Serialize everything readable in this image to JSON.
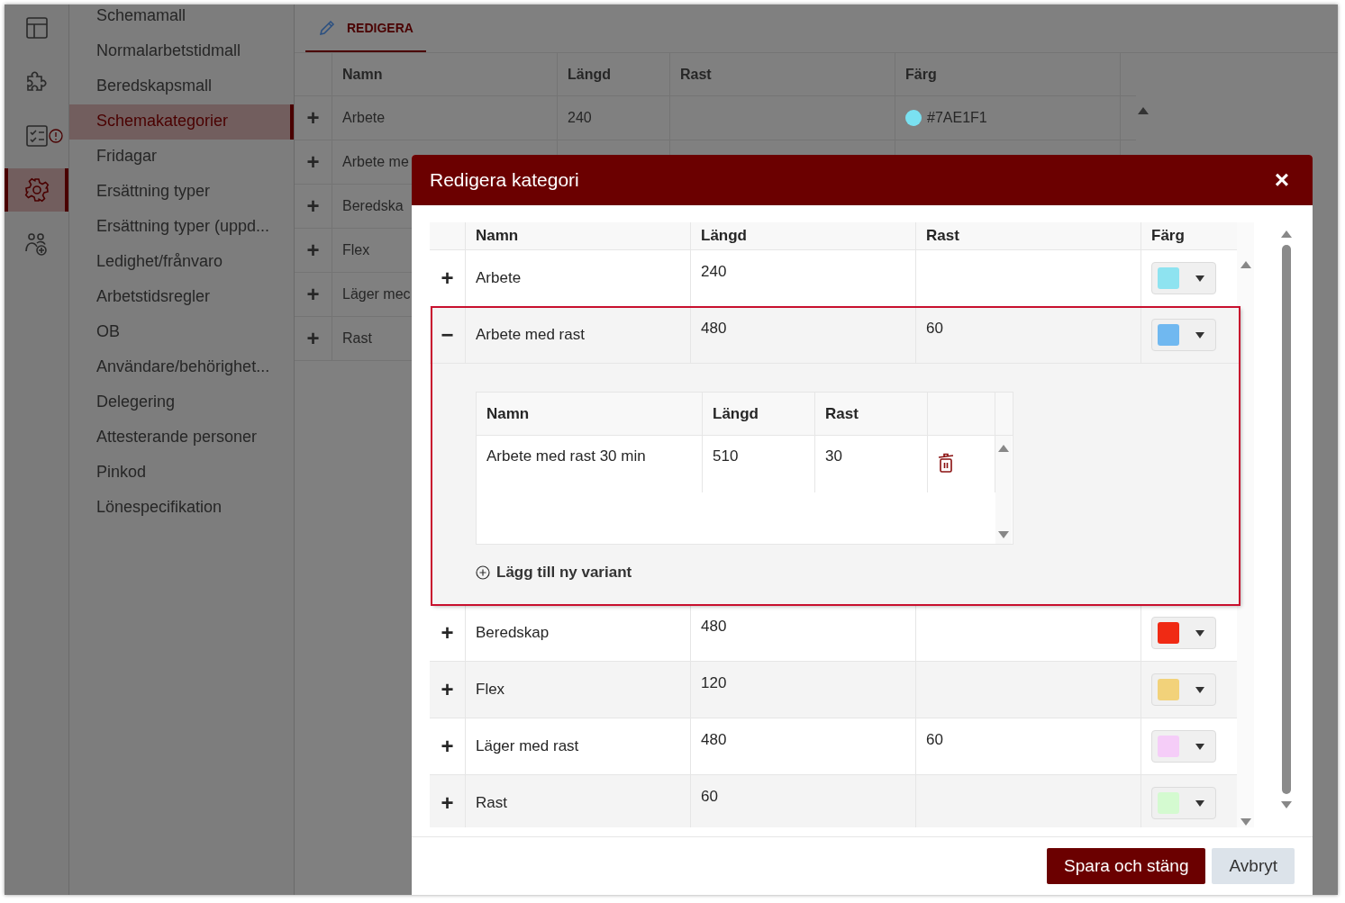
{
  "rail": [
    {
      "kind": "layout",
      "selected": false,
      "alert": false
    },
    {
      "kind": "puzzle",
      "selected": false,
      "alert": false
    },
    {
      "kind": "checklist",
      "selected": false,
      "alert": true
    },
    {
      "kind": "gear",
      "selected": true,
      "alert": false
    },
    {
      "kind": "users",
      "selected": false,
      "alert": false
    }
  ],
  "nav": [
    {
      "label": "Schemamall",
      "selected": false
    },
    {
      "label": "Normalarbetstidmall",
      "selected": false
    },
    {
      "label": "Beredskapsmall",
      "selected": false
    },
    {
      "label": "Schemakategorier",
      "selected": true
    },
    {
      "label": "Fridagar",
      "selected": false
    },
    {
      "label": "Ersättning typer",
      "selected": false
    },
    {
      "label": "Ersättning typer (uppd...",
      "selected": false
    },
    {
      "label": "Ledighet/frånvaro",
      "selected": false
    },
    {
      "label": "Arbetstidsregler",
      "selected": false
    },
    {
      "label": "OB",
      "selected": false
    },
    {
      "label": "Användare/behörighet...",
      "selected": false
    },
    {
      "label": "Delegering",
      "selected": false
    },
    {
      "label": "Attesterande personer",
      "selected": false
    },
    {
      "label": "Pinkod",
      "selected": false
    },
    {
      "label": "Lönespecifikation",
      "selected": false
    }
  ],
  "tab": {
    "label": "REDIGERA",
    "selected": true
  },
  "table": {
    "columns": [
      "Namn",
      "Längd",
      "Rast",
      "Färg"
    ],
    "rows": [
      {
        "toggle": "+",
        "name": "Arbete",
        "length": "240",
        "color_text": "#7AE1F1",
        "color": "#7ae1f1"
      },
      {
        "toggle": "+",
        "name": "Arbete me"
      },
      {
        "toggle": "+",
        "name": "Beredska"
      },
      {
        "toggle": "+",
        "name": "Flex"
      },
      {
        "toggle": "+",
        "name": "Läger mec"
      },
      {
        "toggle": "+",
        "name": "Rast"
      }
    ]
  },
  "dialog": {
    "title": "Redigera kategori",
    "close": "×",
    "columns": [
      "Namn",
      "Längd",
      "Rast",
      "Färg"
    ],
    "rows": [
      {
        "toggle": "+",
        "expanded": false,
        "name": "Arbete",
        "length": "240",
        "color": "#8ee3f0"
      },
      {
        "toggle": "−",
        "expanded": true,
        "name": "Arbete med rast",
        "length": "480",
        "rest": "60",
        "color": "#70b8f0"
      },
      {
        "toggle": "+",
        "expanded": false,
        "name": "Beredskap",
        "length": "480",
        "color": "#f02a14"
      },
      {
        "toggle": "+",
        "expanded": false,
        "name": "Flex",
        "length": "120",
        "color": "#f2d27a"
      },
      {
        "toggle": "+",
        "expanded": false,
        "name": "Läger med rast",
        "length": "480",
        "rest": "60",
        "color": "#f5cdf8"
      },
      {
        "toggle": "+",
        "expanded": false,
        "name": "Rast",
        "length": "60",
        "color": "#d4fad0"
      }
    ],
    "variants": {
      "columns": [
        "Namn",
        "Längd",
        "Rast"
      ],
      "rows": [
        {
          "name": "Arbete med rast 30 min",
          "length": "510",
          "rest": "30"
        }
      ],
      "add": "Lägg till ny variant"
    },
    "buttons": [
      {
        "label": "Spara och stäng",
        "kind": "primary"
      },
      {
        "label": "Avbryt",
        "kind": "secondary"
      }
    ]
  }
}
